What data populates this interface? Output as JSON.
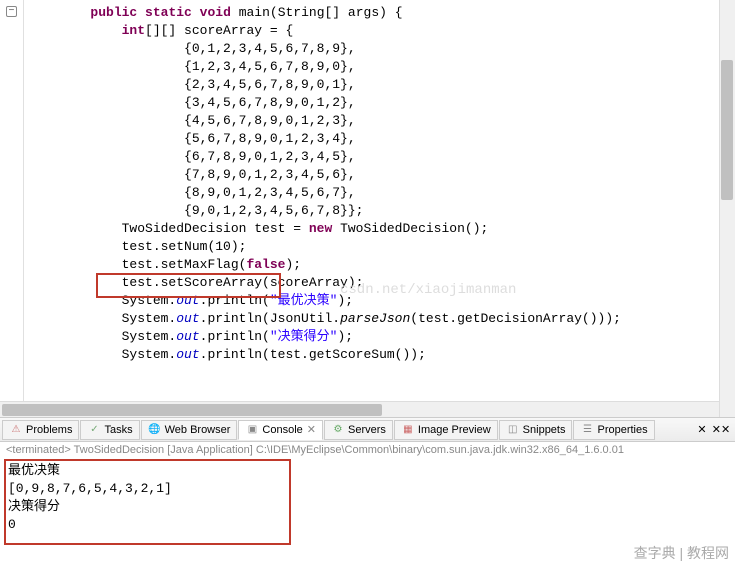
{
  "code": {
    "lines": [
      {
        "indent": 4,
        "parts": [
          {
            "t": "public",
            "c": "kw"
          },
          {
            "t": " "
          },
          {
            "t": "static",
            "c": "kw"
          },
          {
            "t": " "
          },
          {
            "t": "void",
            "c": "kw"
          },
          {
            "t": " main(String[] args) {"
          }
        ]
      },
      {
        "indent": 8,
        "parts": [
          {
            "t": "int",
            "c": "kw"
          },
          {
            "t": "[][] scoreArray = {"
          }
        ]
      },
      {
        "indent": 16,
        "parts": [
          {
            "t": "{0,1,2,3,4,5,6,7,8,9},"
          }
        ]
      },
      {
        "indent": 16,
        "parts": [
          {
            "t": "{1,2,3,4,5,6,7,8,9,0},"
          }
        ]
      },
      {
        "indent": 16,
        "parts": [
          {
            "t": "{2,3,4,5,6,7,8,9,0,1},"
          }
        ]
      },
      {
        "indent": 16,
        "parts": [
          {
            "t": "{3,4,5,6,7,8,9,0,1,2},"
          }
        ]
      },
      {
        "indent": 16,
        "parts": [
          {
            "t": "{4,5,6,7,8,9,0,1,2,3},"
          }
        ]
      },
      {
        "indent": 16,
        "parts": [
          {
            "t": "{5,6,7,8,9,0,1,2,3,4},"
          }
        ]
      },
      {
        "indent": 16,
        "parts": [
          {
            "t": "{6,7,8,9,0,1,2,3,4,5},"
          }
        ]
      },
      {
        "indent": 16,
        "parts": [
          {
            "t": "{7,8,9,0,1,2,3,4,5,6},"
          }
        ]
      },
      {
        "indent": 16,
        "parts": [
          {
            "t": "{8,9,0,1,2,3,4,5,6,7},"
          }
        ]
      },
      {
        "indent": 16,
        "parts": [
          {
            "t": "{9,0,1,2,3,4,5,6,7,8}};"
          }
        ]
      },
      {
        "indent": 8,
        "parts": [
          {
            "t": "TwoSidedDecision test = "
          },
          {
            "t": "new",
            "c": "kw"
          },
          {
            "t": " TwoSidedDecision();"
          }
        ]
      },
      {
        "indent": 8,
        "parts": [
          {
            "t": "test.setNum(10);"
          }
        ]
      },
      {
        "indent": 8,
        "parts": [
          {
            "t": "test.setMaxFlag("
          },
          {
            "t": "false",
            "c": "kw"
          },
          {
            "t": ");"
          }
        ]
      },
      {
        "indent": 8,
        "parts": [
          {
            "t": "test.setScoreArray(scoreArray);"
          }
        ]
      },
      {
        "indent": 8,
        "parts": [
          {
            "t": "System."
          },
          {
            "t": "out",
            "c": "field"
          },
          {
            "t": ".println("
          },
          {
            "t": "\"最优决策\"",
            "c": "str"
          },
          {
            "t": ");"
          }
        ]
      },
      {
        "indent": 8,
        "parts": [
          {
            "t": "System."
          },
          {
            "t": "out",
            "c": "field"
          },
          {
            "t": ".println(JsonUtil."
          },
          {
            "t": "parseJson",
            "c": "method-call"
          },
          {
            "t": "(test.getDecisionArray()));"
          }
        ]
      },
      {
        "indent": 8,
        "parts": [
          {
            "t": "System."
          },
          {
            "t": "out",
            "c": "field"
          },
          {
            "t": ".println("
          },
          {
            "t": "\"决策得分\"",
            "c": "str"
          },
          {
            "t": ");"
          }
        ]
      },
      {
        "indent": 8,
        "parts": [
          {
            "t": "System."
          },
          {
            "t": "out",
            "c": "field"
          },
          {
            "t": ".println(test.getScoreSum());"
          }
        ]
      }
    ]
  },
  "tabs": [
    {
      "name": "problems",
      "label": "Problems",
      "iconClass": "icon-problems",
      "icon": "⚠"
    },
    {
      "name": "tasks",
      "label": "Tasks",
      "iconClass": "icon-tasks",
      "icon": "✓"
    },
    {
      "name": "web-browser",
      "label": "Web Browser",
      "iconClass": "icon-browser",
      "icon": "🌐"
    },
    {
      "name": "console",
      "label": "Console",
      "iconClass": "icon-console",
      "icon": "▣",
      "active": true,
      "closable": true
    },
    {
      "name": "servers",
      "label": "Servers",
      "iconClass": "icon-servers",
      "icon": "⚙"
    },
    {
      "name": "image-preview",
      "label": "Image Preview",
      "iconClass": "icon-image",
      "icon": "▦"
    },
    {
      "name": "snippets",
      "label": "Snippets",
      "iconClass": "icon-snippets",
      "icon": "◫"
    },
    {
      "name": "properties",
      "label": "Properties",
      "iconClass": "icon-properties",
      "icon": "☰"
    }
  ],
  "console": {
    "status": "<terminated> TwoSidedDecision [Java Application] C:\\IDE\\MyEclipse\\Common\\binary\\com.sun.java.jdk.win32.x86_64_1.6.0.01",
    "output": [
      "最优决策",
      "[0,9,8,7,6,5,4,3,2,1]",
      "决策得分",
      "0"
    ]
  },
  "watermark1": "csdn.net/xiaojimanman",
  "watermark2": "查字典 | 教程网"
}
